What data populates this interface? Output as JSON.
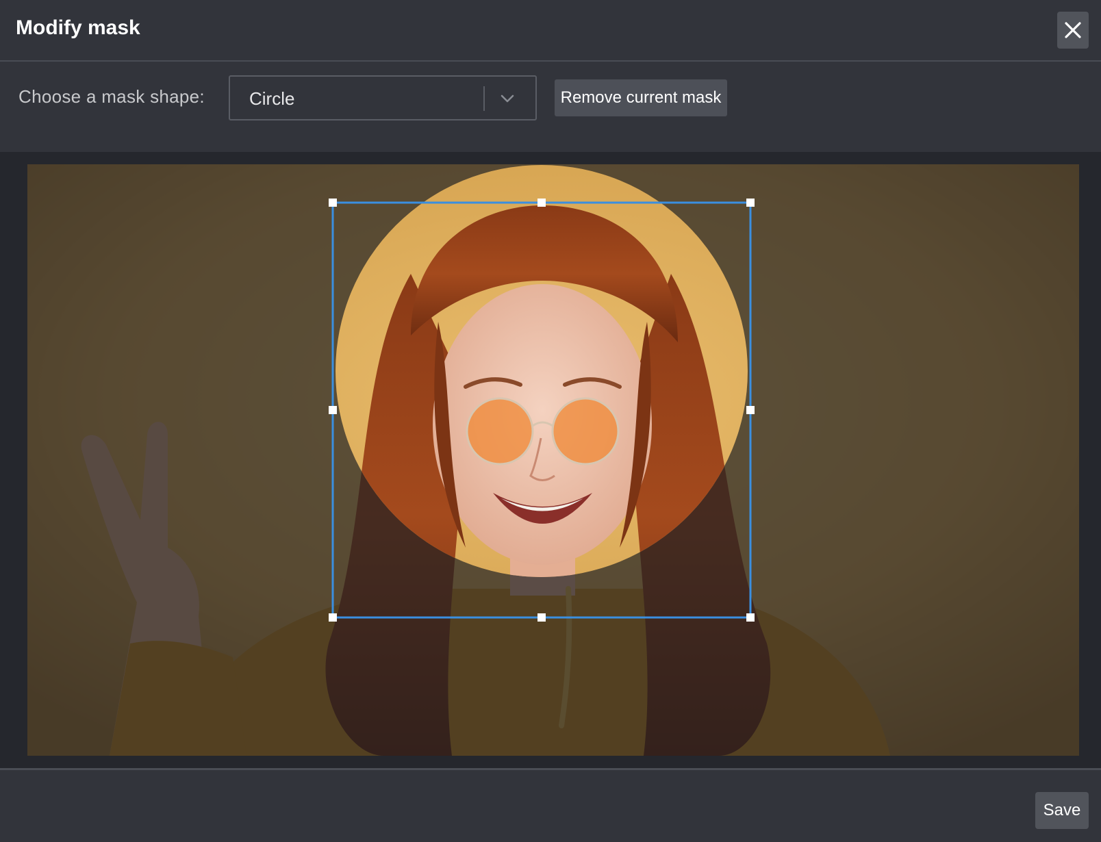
{
  "dialog": {
    "title": "Modify mask",
    "close_icon": "close-icon"
  },
  "toolbar": {
    "shape_label": "Choose a mask shape:",
    "shape_select": {
      "selected": "Circle",
      "icon": "chevron-down-icon"
    },
    "remove_mask_label": "Remove current mask"
  },
  "editor": {
    "mask_shape": "circle",
    "selection_color": "#3a8fe0",
    "handle_color": "#ffffff"
  },
  "footer": {
    "save_label": "Save"
  }
}
